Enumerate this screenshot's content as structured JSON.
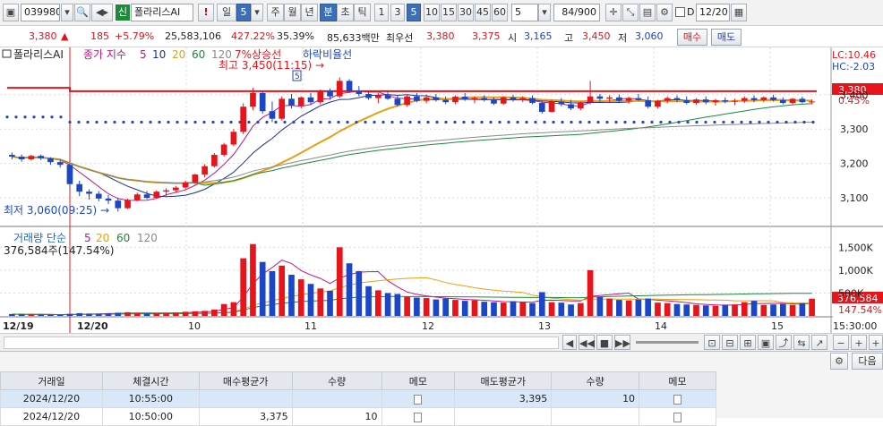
{
  "toolbar": {
    "code": "039980",
    "name": "폴라리스AI",
    "badge": "신",
    "alert": "!",
    "period_sel": "일",
    "period_num": "5",
    "periods": [
      "주",
      "월",
      "년",
      "분",
      "초",
      "틱"
    ],
    "nums": [
      "1",
      "3",
      "5",
      "10",
      "15",
      "30",
      "45",
      "60"
    ],
    "unit_value": "5",
    "count": "84/900",
    "date_check_label": "D",
    "date": "12/20"
  },
  "quote": {
    "price": "3,380",
    "change": "185",
    "change_pct": "+5.79%",
    "volume": "25,583,106",
    "vol_ratio": "427.22%",
    "turnover": "35.39%",
    "amount": "85,633백만",
    "best_ask_label": "최우선",
    "best_ask": "3,380",
    "best_bid": "3,375",
    "open_label": "시",
    "open": "3,165",
    "high_label": "고",
    "high": "3,450",
    "low_label": "저",
    "low": "3,060",
    "buy_label": "매수",
    "sell_label": "매도"
  },
  "legend": {
    "name": "폴라리스AI",
    "ma_title": "종가 지수",
    "ma5": "5",
    "ma10": "10",
    "ma20": "20",
    "ma60": "60",
    "ma120": "120",
    "up_line": "7%상승선",
    "down_line": "하락비율선",
    "high_note": "최고 3,450(11:15) →",
    "low_note": "최저 3,060(09:25) →",
    "lc": "LC:10.46",
    "hc": "HC:-2.03",
    "cur_price_tag": "3,380",
    "pct_tag": "0.45%",
    "vol_title": "거래량 단순",
    "vol_ma5": "5",
    "vol_ma20": "20",
    "vol_ma60": "60",
    "vol_ma120": "120",
    "vol_now": "376,584주(147.54%)",
    "vol_tag": "376,584",
    "vol_pct_tag": "147.54%"
  },
  "colors": {
    "up": "#e8141c",
    "down": "#1c46c8",
    "ma5": "#c0148a",
    "ma10": "#1a2f9c",
    "ma20": "#e8a010",
    "ma60": "#1b8a3a",
    "ma120": "#8a8a8a"
  },
  "chart_data": {
    "type": "candlestick",
    "price_axis": [
      "3,400",
      "3,300",
      "3,200",
      "3,100"
    ],
    "volume_axis": [
      "1,500K",
      "1,000K",
      "500K"
    ],
    "x_labels": [
      "12/19",
      "12/20",
      "10",
      "11",
      "12",
      "13",
      "14",
      "15",
      "15:30:00"
    ],
    "ylim": [
      3030,
      3480
    ],
    "candles": [
      [
        3225,
        3232,
        3212,
        3220
      ],
      [
        3220,
        3226,
        3205,
        3212
      ],
      [
        3212,
        3225,
        3208,
        3222
      ],
      [
        3222,
        3226,
        3210,
        3215
      ],
      [
        3215,
        3218,
        3196,
        3204
      ],
      [
        3204,
        3210,
        3188,
        3196
      ],
      [
        3196,
        3200,
        3130,
        3140
      ],
      [
        3140,
        3150,
        3105,
        3118
      ],
      [
        3118,
        3125,
        3095,
        3112
      ],
      [
        3112,
        3120,
        3090,
        3098
      ],
      [
        3098,
        3108,
        3082,
        3092
      ],
      [
        3092,
        3100,
        3060,
        3070
      ],
      [
        3070,
        3098,
        3068,
        3094
      ],
      [
        3094,
        3115,
        3090,
        3110
      ],
      [
        3110,
        3120,
        3096,
        3100
      ],
      [
        3100,
        3122,
        3098,
        3118
      ],
      [
        3118,
        3128,
        3105,
        3122
      ],
      [
        3122,
        3135,
        3115,
        3130
      ],
      [
        3130,
        3150,
        3125,
        3145
      ],
      [
        3145,
        3170,
        3140,
        3168
      ],
      [
        3168,
        3198,
        3160,
        3192
      ],
      [
        3192,
        3230,
        3188,
        3225
      ],
      [
        3225,
        3260,
        3220,
        3255
      ],
      [
        3255,
        3300,
        3250,
        3292
      ],
      [
        3292,
        3375,
        3285,
        3365
      ],
      [
        3365,
        3420,
        3355,
        3405
      ],
      [
        3405,
        3410,
        3345,
        3352
      ],
      [
        3352,
        3380,
        3320,
        3330
      ],
      [
        3330,
        3395,
        3325,
        3388
      ],
      [
        3388,
        3402,
        3360,
        3368
      ],
      [
        3368,
        3395,
        3360,
        3392
      ],
      [
        3392,
        3405,
        3370,
        3378
      ],
      [
        3378,
        3415,
        3372,
        3410
      ],
      [
        3410,
        3418,
        3385,
        3395
      ],
      [
        3395,
        3450,
        3390,
        3440
      ],
      [
        3440,
        3445,
        3405,
        3410
      ],
      [
        3410,
        3425,
        3395,
        3402
      ],
      [
        3402,
        3410,
        3385,
        3390
      ],
      [
        3390,
        3405,
        3375,
        3398
      ],
      [
        3398,
        3412,
        3385,
        3388
      ],
      [
        3388,
        3400,
        3365,
        3370
      ],
      [
        3370,
        3398,
        3365,
        3395
      ],
      [
        3395,
        3405,
        3378,
        3382
      ],
      [
        3382,
        3400,
        3375,
        3392
      ],
      [
        3392,
        3402,
        3380,
        3385
      ],
      [
        3385,
        3395,
        3372,
        3378
      ],
      [
        3378,
        3398,
        3372,
        3394
      ],
      [
        3394,
        3405,
        3382,
        3386
      ],
      [
        3386,
        3395,
        3375,
        3390
      ],
      [
        3390,
        3398,
        3380,
        3384
      ],
      [
        3384,
        3392,
        3370,
        3374
      ],
      [
        3374,
        3395,
        3370,
        3392
      ],
      [
        3392,
        3400,
        3380,
        3384
      ],
      [
        3384,
        3395,
        3378,
        3390
      ],
      [
        3390,
        3398,
        3372,
        3376
      ],
      [
        3376,
        3382,
        3345,
        3350
      ],
      [
        3350,
        3385,
        3348,
        3380
      ],
      [
        3380,
        3390,
        3366,
        3372
      ],
      [
        3372,
        3385,
        3355,
        3360
      ],
      [
        3360,
        3380,
        3355,
        3378
      ],
      [
        3378,
        3440,
        3372,
        3395
      ],
      [
        3395,
        3402,
        3380,
        3388
      ],
      [
        3388,
        3398,
        3376,
        3392
      ],
      [
        3392,
        3400,
        3378,
        3382
      ],
      [
        3382,
        3394,
        3374,
        3390
      ],
      [
        3390,
        3402,
        3382,
        3384
      ],
      [
        3384,
        3395,
        3360,
        3365
      ],
      [
        3365,
        3385,
        3360,
        3382
      ],
      [
        3382,
        3395,
        3375,
        3390
      ],
      [
        3390,
        3398,
        3378,
        3384
      ],
      [
        3384,
        3395,
        3372,
        3376
      ],
      [
        3376,
        3390,
        3370,
        3386
      ],
      [
        3386,
        3395,
        3372,
        3378
      ],
      [
        3378,
        3388,
        3368,
        3384
      ],
      [
        3384,
        3392,
        3375,
        3380
      ],
      [
        3380,
        3388,
        3370,
        3382
      ],
      [
        3382,
        3395,
        3376,
        3390
      ],
      [
        3390,
        3398,
        3378,
        3384
      ],
      [
        3384,
        3395,
        3378,
        3392
      ],
      [
        3392,
        3400,
        3380,
        3384
      ],
      [
        3384,
        3392,
        3372,
        3376
      ],
      [
        3376,
        3390,
        3372,
        3388
      ],
      [
        3388,
        3394,
        3375,
        3378
      ],
      [
        3378,
        3386,
        3372,
        3380
      ]
    ],
    "volume": [
      40,
      35,
      30,
      28,
      25,
      22,
      45,
      60,
      50,
      48,
      55,
      70,
      80,
      60,
      55,
      62,
      70,
      75,
      90,
      100,
      110,
      140,
      260,
      300,
      1260,
      1570,
      1180,
      980,
      1100,
      900,
      800,
      700,
      600,
      550,
      1500,
      1150,
      980,
      650,
      560,
      500,
      480,
      420,
      400,
      390,
      360,
      380,
      350,
      330,
      340,
      310,
      300,
      290,
      320,
      300,
      280,
      520,
      300,
      290,
      250,
      280,
      1000,
      420,
      380,
      350,
      340,
      360,
      380,
      290,
      280,
      260,
      250,
      240,
      230,
      220,
      240,
      250,
      300,
      330,
      240,
      250,
      260,
      240,
      280,
      377
    ]
  },
  "scroll": {
    "controls": [
      "◀◀",
      "■",
      "▶▶"
    ]
  },
  "table": {
    "settings_label": "다음",
    "headers": [
      "거래일",
      "체결시간",
      "매수평균가",
      "수량",
      "메모",
      "매도평균가",
      "수량",
      "메모"
    ],
    "rows": [
      {
        "date": "2024/12/20",
        "time": "10:55:00",
        "buy_avg": "",
        "buy_qty": "",
        "sell_avg": "3,395",
        "sell_qty": "10"
      },
      {
        "date": "2024/12/20",
        "time": "10:50:00",
        "buy_avg": "3,375",
        "buy_qty": "10",
        "sell_avg": "",
        "sell_qty": ""
      }
    ]
  }
}
